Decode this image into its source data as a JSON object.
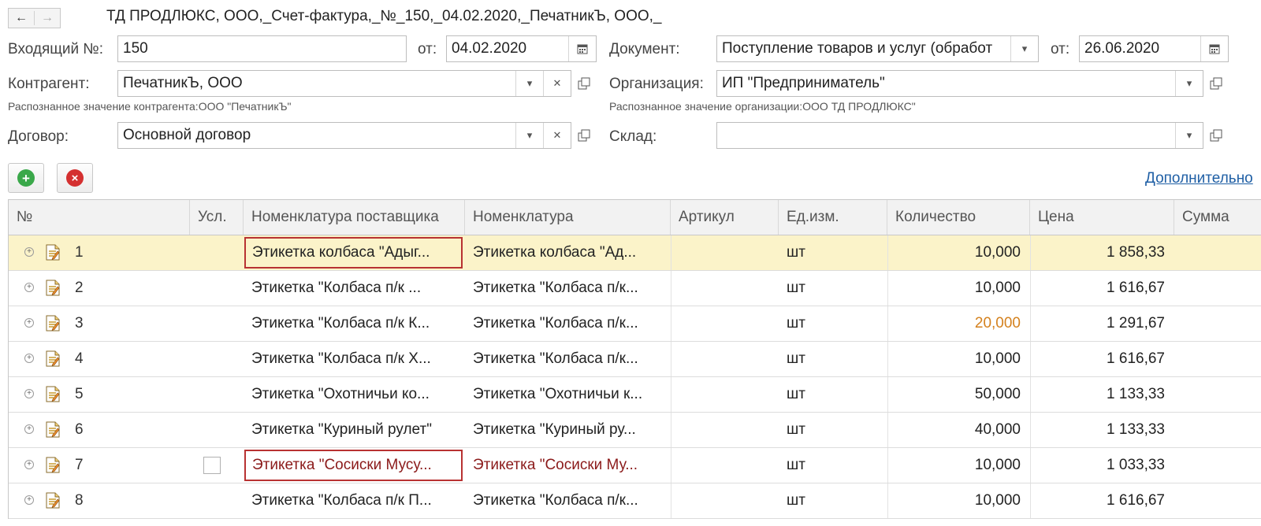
{
  "window": {
    "title": "ТД ПРОДЛЮКС, ООО,_Счет-фактура,_№_150,_04.02.2020,_ПечатникЪ, ООО,_",
    "nav_back": "←",
    "nav_forward": "→"
  },
  "form": {
    "incoming_label": "Входящий №:",
    "incoming_value": "150",
    "from_label": "от:",
    "incoming_date": "04.02.2020",
    "document_label": "Документ:",
    "document_value": "Поступление товаров и услуг (обработ",
    "document_date": "26.06.2020",
    "counterparty_label": "Контрагент:",
    "counterparty_value": "ПечатникЪ, ООО",
    "counterparty_hint": "Распознанное значение контрагента:ООО \"ПечатникЪ\"",
    "organization_label": "Организация:",
    "organization_value": "ИП \"Предприниматель\"",
    "organization_hint": "Распознанное значение организации:ООО ТД ПРОДЛЮКС\"",
    "contract_label": "Договор:",
    "contract_value": "Основной договор",
    "warehouse_label": "Склад:",
    "warehouse_value": ""
  },
  "toolbar": {
    "add_icon": "+",
    "delete_icon": "×",
    "additional_link": "Дополнительно"
  },
  "table": {
    "columns": [
      "№",
      "Усл.",
      "Номенклатура поставщика",
      "Номенклатура",
      "Артикул",
      "Ед.изм.",
      "Количество",
      "Цена",
      "Сумма"
    ],
    "rows": [
      {
        "num": "1",
        "supplier_item": "Этикетка колбаса \"Адыг...",
        "item": "Этикетка колбаса \"Ад...",
        "article": "",
        "unit": "шт",
        "qty": "10,000",
        "price": "1 858,33",
        "sum": ""
      },
      {
        "num": "2",
        "supplier_item": "Этикетка \"Колбаса п/к ...",
        "item": "Этикетка \"Колбаса п/к...",
        "article": "",
        "unit": "шт",
        "qty": "10,000",
        "price": "1 616,67",
        "sum": ""
      },
      {
        "num": "3",
        "supplier_item": "Этикетка \"Колбаса п/к К...",
        "item": "Этикетка \"Колбаса п/к...",
        "article": "",
        "unit": "шт",
        "qty": "20,000",
        "price": "1 291,67",
        "sum": ""
      },
      {
        "num": "4",
        "supplier_item": "Этикетка \"Колбаса п/к Х...",
        "item": "Этикетка \"Колбаса п/к...",
        "article": "",
        "unit": "шт",
        "qty": "10,000",
        "price": "1 616,67",
        "sum": ""
      },
      {
        "num": "5",
        "supplier_item": "Этикетка \"Охотничьи ко...",
        "item": "Этикетка \"Охотничьи к...",
        "article": "",
        "unit": "шт",
        "qty": "50,000",
        "price": "1 133,33",
        "sum": ""
      },
      {
        "num": "6",
        "supplier_item": "Этикетка \"Куриный рулет\"",
        "item": "Этикетка \"Куриный ру...",
        "article": "",
        "unit": "шт",
        "qty": "40,000",
        "price": "1 133,33",
        "sum": ""
      },
      {
        "num": "7",
        "supplier_item": "Этикетка \"Сосиски Мусу...",
        "item": "Этикетка \"Сосиски Му...",
        "article": "",
        "unit": "шт",
        "qty": "10,000",
        "price": "1 033,33",
        "sum": ""
      },
      {
        "num": "8",
        "supplier_item": "Этикетка \"Колбаса п/к П...",
        "item": "Этикетка \"Колбаса п/к...",
        "article": "",
        "unit": "шт",
        "qty": "10,000",
        "price": "1 616,67",
        "sum": ""
      }
    ]
  },
  "colors": {
    "selected_row": "#fbf3c9",
    "highlight_qty": "#d4811e",
    "unmatched_text": "#8b1a1a",
    "error_border": "#b83232"
  }
}
